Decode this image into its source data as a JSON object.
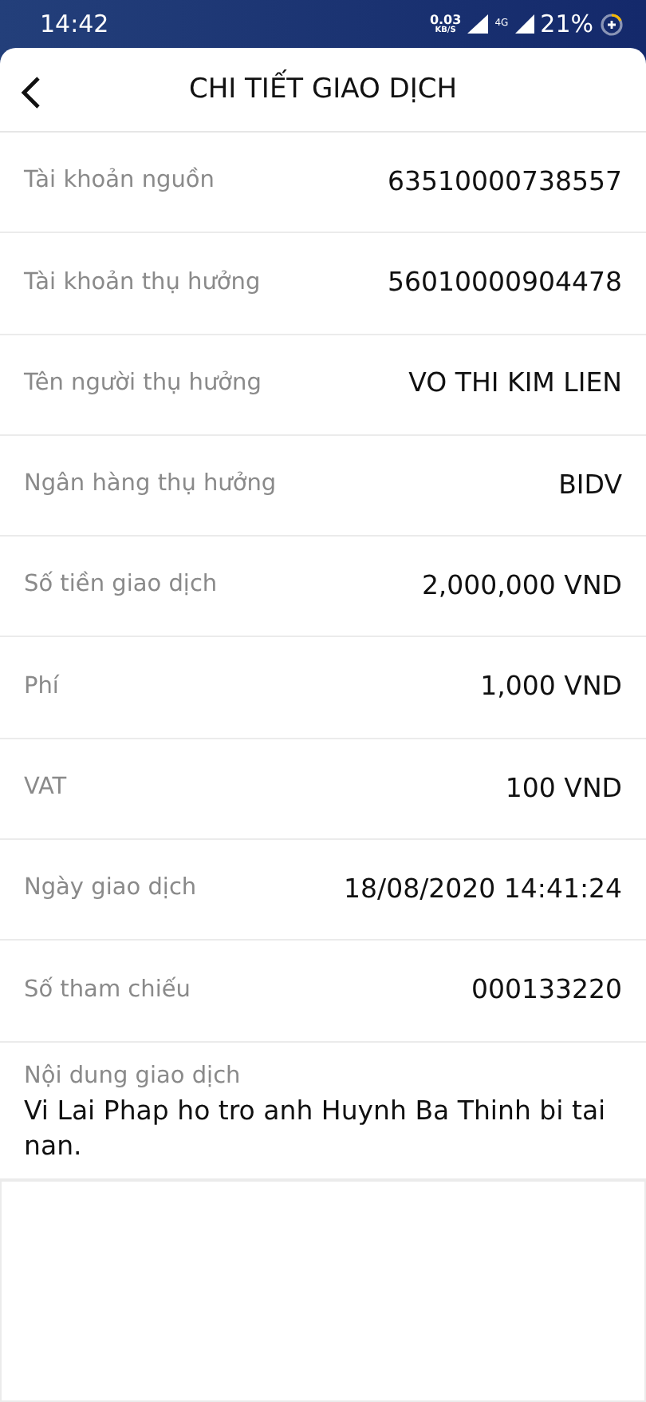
{
  "status_bar": {
    "time": "14:42",
    "speed": "0.03",
    "speed_unit": "KB/S",
    "network": "4G",
    "battery": "21%"
  },
  "header": {
    "title": "CHI TIẾT GIAO DỊCH"
  },
  "details": [
    {
      "label": "Tài khoản nguồn",
      "value": "63510000738557"
    },
    {
      "label": "Tài khoản thụ hưởng",
      "value": "56010000904478"
    },
    {
      "label": "Tên người thụ hưởng",
      "value": "VO THI KIM LIEN"
    },
    {
      "label": "Ngân hàng thụ hưởng",
      "value": "BIDV"
    },
    {
      "label": "Số tiền giao dịch",
      "value": "2,000,000 VND"
    },
    {
      "label": "Phí",
      "value": "1,000 VND"
    },
    {
      "label": "VAT",
      "value": "100 VND"
    },
    {
      "label": "Ngày giao dịch",
      "value": "18/08/2020 14:41:24"
    },
    {
      "label": "Số tham chiếu",
      "value": "000133220"
    }
  ],
  "content": {
    "label": "Nội dung giao dịch",
    "value": "Vi Lai Phap ho tro anh Huynh Ba Thinh bi tai nan."
  }
}
